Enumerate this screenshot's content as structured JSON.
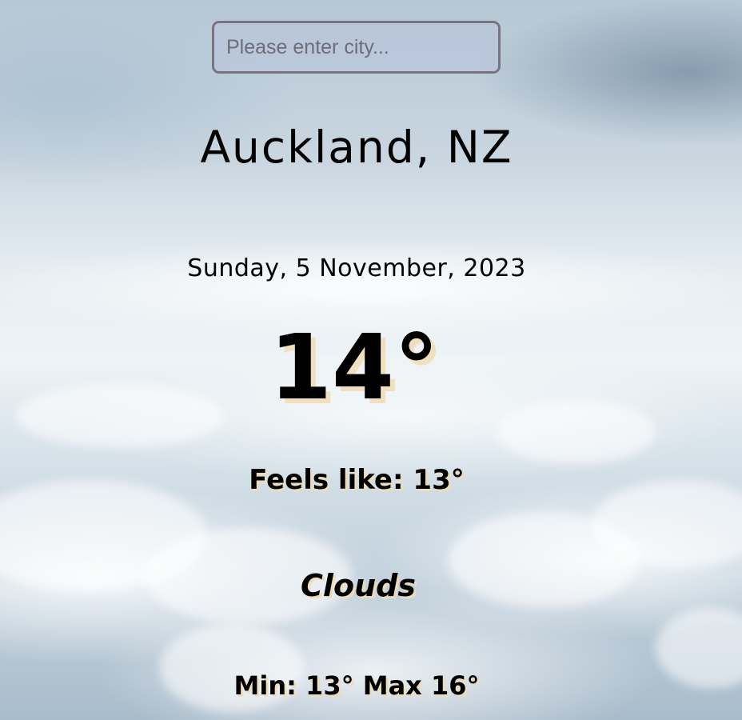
{
  "search": {
    "placeholder": "Please enter city...",
    "value": ""
  },
  "location": {
    "city": "Auckland, NZ"
  },
  "date": "Sunday, 5 November, 2023",
  "weather": {
    "temperature": "14°",
    "feels_like": "Feels like: 13°",
    "condition": "Clouds",
    "min_max": "Min: 13° Max 16°"
  },
  "colors": {
    "text": "#000000",
    "search_border": "#7a7480",
    "text_shadow": "#f0dcb4"
  }
}
